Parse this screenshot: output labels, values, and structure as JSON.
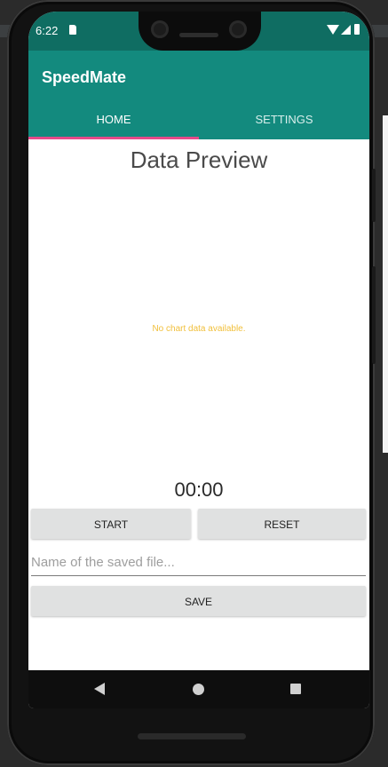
{
  "status_bar": {
    "time": "6:22"
  },
  "app_bar": {
    "title": "SpeedMate"
  },
  "tabs": [
    {
      "label": "HOME",
      "selected": true
    },
    {
      "label": "SETTINGS",
      "selected": false
    }
  ],
  "main": {
    "title": "Data Preview",
    "empty_chart_text": "No chart data available.",
    "timer": "00:00"
  },
  "controls": {
    "start_label": "START",
    "reset_label": "RESET",
    "filename_placeholder": "Name of the saved file...",
    "filename_value": "",
    "save_label": "SAVE"
  },
  "icons": {
    "status": [
      "sd-card-icon",
      "wifi-icon",
      "cell-signal-icon",
      "battery-icon"
    ],
    "nav": [
      "back-icon",
      "home-icon",
      "recents-icon"
    ]
  },
  "colors": {
    "status_bar": "#0f6d62",
    "app_bar": "#138a7e",
    "tab_indicator": "#e64a8a",
    "empty_chart_text": "#f1c03c",
    "button": "#e0e1e1"
  }
}
